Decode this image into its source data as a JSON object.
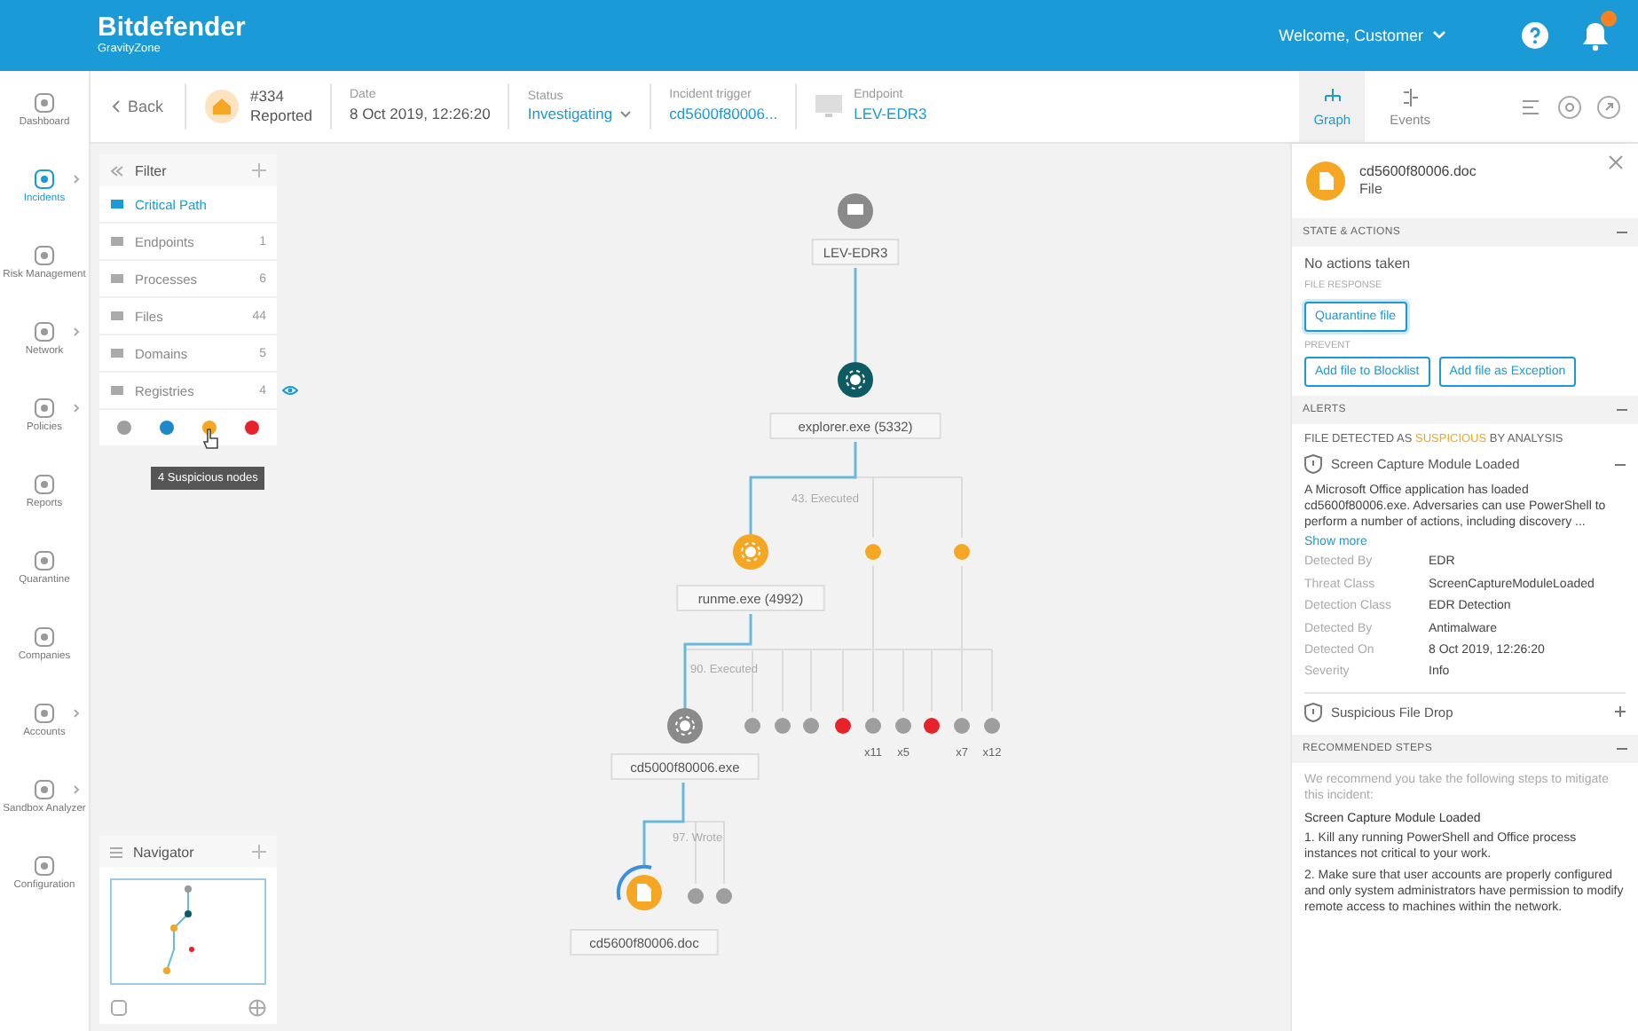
{
  "header": {
    "brand": "Bitdefender",
    "product": "GravityZone",
    "welcome": "Welcome, Customer",
    "notification_badge": true
  },
  "nav": [
    {
      "label": "Dashboard",
      "selected": false,
      "submenu": false
    },
    {
      "label": "Incidents",
      "selected": true,
      "submenu": true
    },
    {
      "label": "Risk Management",
      "selected": false,
      "submenu": false
    },
    {
      "label": "Network",
      "selected": false,
      "submenu": true
    },
    {
      "label": "Policies",
      "selected": false,
      "submenu": true
    },
    {
      "label": "Reports",
      "selected": false,
      "submenu": false
    },
    {
      "label": "Quarantine",
      "selected": false,
      "submenu": false
    },
    {
      "label": "Companies",
      "selected": false,
      "submenu": false
    },
    {
      "label": "Accounts",
      "selected": false,
      "submenu": true
    },
    {
      "label": "Sandbox Analyzer",
      "selected": false,
      "submenu": true
    },
    {
      "label": "Configuration",
      "selected": false,
      "submenu": false
    }
  ],
  "incident": {
    "back": "Back",
    "number": "#334",
    "state": "Reported",
    "date_label": "Date",
    "date": "8 Oct 2019, 12:26:20",
    "status_label": "Status",
    "status": "Investigating",
    "trigger_label": "Incident trigger",
    "trigger": "cd5600f80006...",
    "endpoint_label": "Endpoint",
    "endpoint": "LEV-EDR3"
  },
  "view_tabs": [
    {
      "label": "Graph",
      "selected": true
    },
    {
      "label": "Events",
      "selected": false
    }
  ],
  "filter": {
    "title": "Filter",
    "items": [
      {
        "label": "Critical Path",
        "selected": true,
        "visible": false
      },
      {
        "label": "Endpoints",
        "count": "1",
        "selected": false,
        "visible": false
      },
      {
        "label": "Processes",
        "count": "6",
        "selected": false,
        "visible": false
      },
      {
        "label": "Files",
        "count": "44",
        "selected": false,
        "visible": false
      },
      {
        "label": "Domains",
        "count": "5",
        "selected": false,
        "visible": false
      },
      {
        "label": "Registries",
        "count": "4",
        "selected": false,
        "visible": true
      }
    ],
    "colors": [
      {
        "color": "#9e9e9e"
      },
      {
        "color": "#1e88c8"
      },
      {
        "color": "#f5a623"
      },
      {
        "color": "#e8222a"
      }
    ],
    "tooltip": "4 Suspicious nodes"
  },
  "navigator": {
    "title": "Navigator"
  },
  "graph": {
    "nodes": [
      {
        "label": "LEV-EDR3",
        "kind": "endpoint",
        "color": "#8a8a8a"
      },
      {
        "label": "explorer.exe (5332)",
        "kind": "process",
        "color": "#0d5c63"
      },
      {
        "label": "runme.exe (4992)",
        "kind": "process",
        "color": "#f5a623"
      },
      {
        "label": "cd5000f80006.exe",
        "kind": "process",
        "color": "#8a8a8a"
      },
      {
        "label": "cd5600f80006.doc",
        "kind": "file",
        "color": "#f5a623"
      }
    ],
    "edge_labels": [
      "43. Executed",
      "90. Executed",
      "97. Wrote"
    ],
    "small_nodes": [
      {
        "color": "#f5a623"
      },
      {
        "color": "#f5a623"
      },
      {
        "color": "#9e9e9e"
      },
      {
        "color": "#9e9e9e"
      },
      {
        "color": "#9e9e9e"
      },
      {
        "color": "#e8222a"
      },
      {
        "color": "#9e9e9e",
        "count": "x11"
      },
      {
        "color": "#9e9e9e",
        "count": "x5"
      },
      {
        "color": "#e8222a"
      },
      {
        "color": "#9e9e9e",
        "count": "x7"
      },
      {
        "color": "#9e9e9e",
        "count": "x12"
      },
      {
        "color": "#9e9e9e"
      },
      {
        "color": "#9e9e9e"
      }
    ]
  },
  "details": {
    "title": "cd5600f80006.doc",
    "type": "File",
    "state_actions": {
      "title": "STATE & ACTIONS",
      "expanded": true,
      "status": "No actions taken",
      "response_label": "FILE RESPONSE",
      "quarantine": "Quarantine file",
      "prevent_label": "PREVENT",
      "blocklist": "Add file to Blocklist",
      "exception": "Add file as Exception"
    },
    "alerts": {
      "title": "ALERTS",
      "expanded": true,
      "detected_prefix": "FILE DETECTED AS",
      "detected_word": "SUSPICIOUS",
      "detected_suffix": "BY ANALYSIS",
      "items": [
        {
          "title": "Screen Capture Module Loaded",
          "expanded": true,
          "description": "A Microsoft Office application has loaded cd5600f80006.exe. Adversaries can use PowerShell to perform a number of actions, including discovery ...",
          "show_more": "Show more",
          "fields": [
            {
              "label": "Detected By",
              "value": "EDR"
            },
            {
              "label": "Threat Class",
              "value": "ScreenCaptureModuleLoaded"
            },
            {
              "label": "Detection Class",
              "value": "EDR Detection"
            },
            {
              "label": "Detected By",
              "value": "Antimalware"
            },
            {
              "label": "Detected On",
              "value": "8 Oct 2019, 12:26:20"
            },
            {
              "label": "Severity",
              "value": "Info"
            }
          ]
        },
        {
          "title": "Suspicious File Drop",
          "expanded": false
        }
      ]
    },
    "recommended": {
      "title": "RECOMMENDED STEPS",
      "expanded": true,
      "intro": "We recommend you take the following steps to mitigate this incident:",
      "heading": "Screen Capture Module Loaded",
      "steps": [
        "1. Kill any running PowerShell and Office process instances not critical to your work.",
        "2. Make sure that user accounts are properly configured and only system administrators have permission to modify remote access to machines within the network."
      ]
    }
  }
}
